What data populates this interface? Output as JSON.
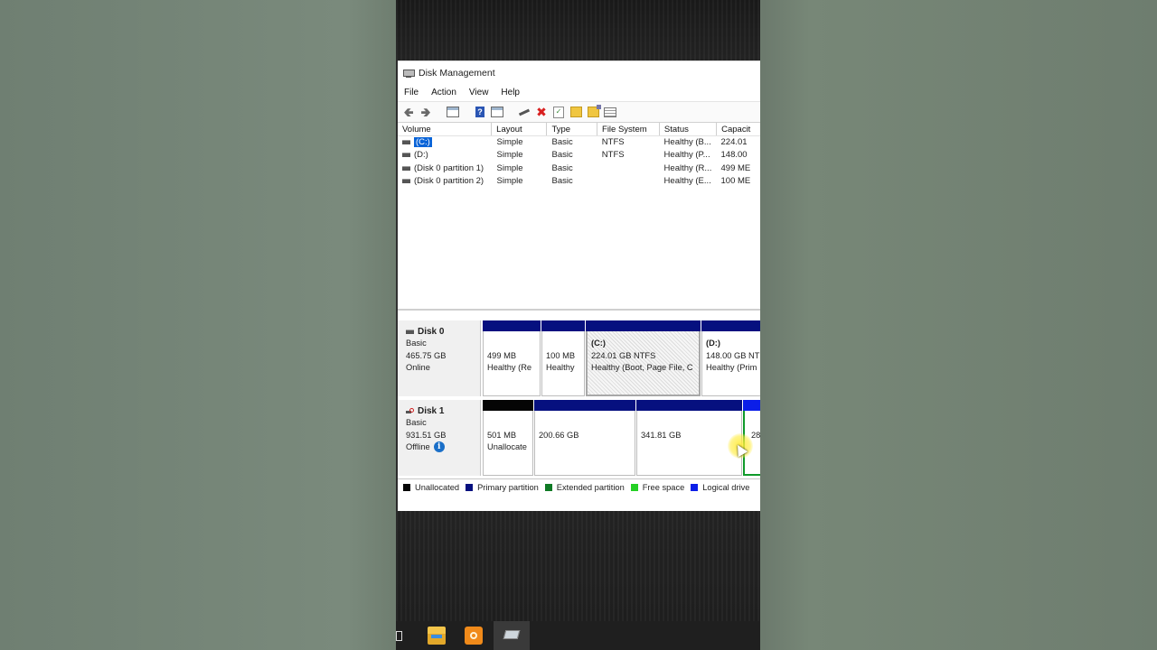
{
  "window": {
    "title": "Disk Management"
  },
  "menu": [
    "File",
    "Action",
    "View",
    "Help"
  ],
  "toolbar_icons": [
    "back-arrow-icon",
    "forward-arrow-icon",
    "console-tree-icon",
    "help-icon",
    "properties-icon",
    "connect-icon",
    "delete-icon",
    "check-icon",
    "folder-icon",
    "folder-open-icon",
    "list-icon"
  ],
  "volume_table": {
    "headers": [
      "Volume",
      "Layout",
      "Type",
      "File System",
      "Status",
      "Capacit"
    ],
    "rows": [
      {
        "volume": "(C:)",
        "layout": "Simple",
        "type": "Basic",
        "fs": "NTFS",
        "status": "Healthy (B...",
        "capacity": "224.01"
      },
      {
        "volume": "(D:)",
        "layout": "Simple",
        "type": "Basic",
        "fs": "NTFS",
        "status": "Healthy (P...",
        "capacity": "148.00"
      },
      {
        "volume": "(Disk 0 partition 1)",
        "layout": "Simple",
        "type": "Basic",
        "fs": "",
        "status": "Healthy (R...",
        "capacity": "499 ME"
      },
      {
        "volume": "(Disk 0 partition 2)",
        "layout": "Simple",
        "type": "Basic",
        "fs": "",
        "status": "Healthy (E...",
        "capacity": "100 ME"
      }
    ]
  },
  "disk0": {
    "name": "Disk 0",
    "type": "Basic",
    "size": "465.75 GB",
    "state": "Online",
    "partitions": [
      {
        "title": "",
        "line1": "499 MB",
        "line2": "Healthy (Re"
      },
      {
        "title": "",
        "line1": "100 MB",
        "line2": "Healthy"
      },
      {
        "title": "(C:)",
        "line1": "224.01 GB NTFS",
        "line2": "Healthy (Boot, Page File, C"
      },
      {
        "title": "(D:)",
        "line1": "148.00 GB NT",
        "line2": "Healthy (Prim"
      }
    ]
  },
  "disk1": {
    "name": "Disk 1",
    "type": "Basic",
    "size": "931.51 GB",
    "state": "Offline",
    "partitions": [
      {
        "line1": "501 MB",
        "line2": "Unallocate"
      },
      {
        "line1": "200.66 GB",
        "line2": ""
      },
      {
        "line1": "341.81 GB",
        "line2": ""
      },
      {
        "line1": "28",
        "line2": ""
      }
    ]
  },
  "legend": [
    {
      "label": "Unallocated",
      "color": "#050505"
    },
    {
      "label": "Primary partition",
      "color": "#06107f"
    },
    {
      "label": "Extended partition",
      "color": "#0f7a25"
    },
    {
      "label": "Free space",
      "color": "#25d025"
    },
    {
      "label": "Logical drive",
      "color": "#0b1ee8"
    }
  ]
}
